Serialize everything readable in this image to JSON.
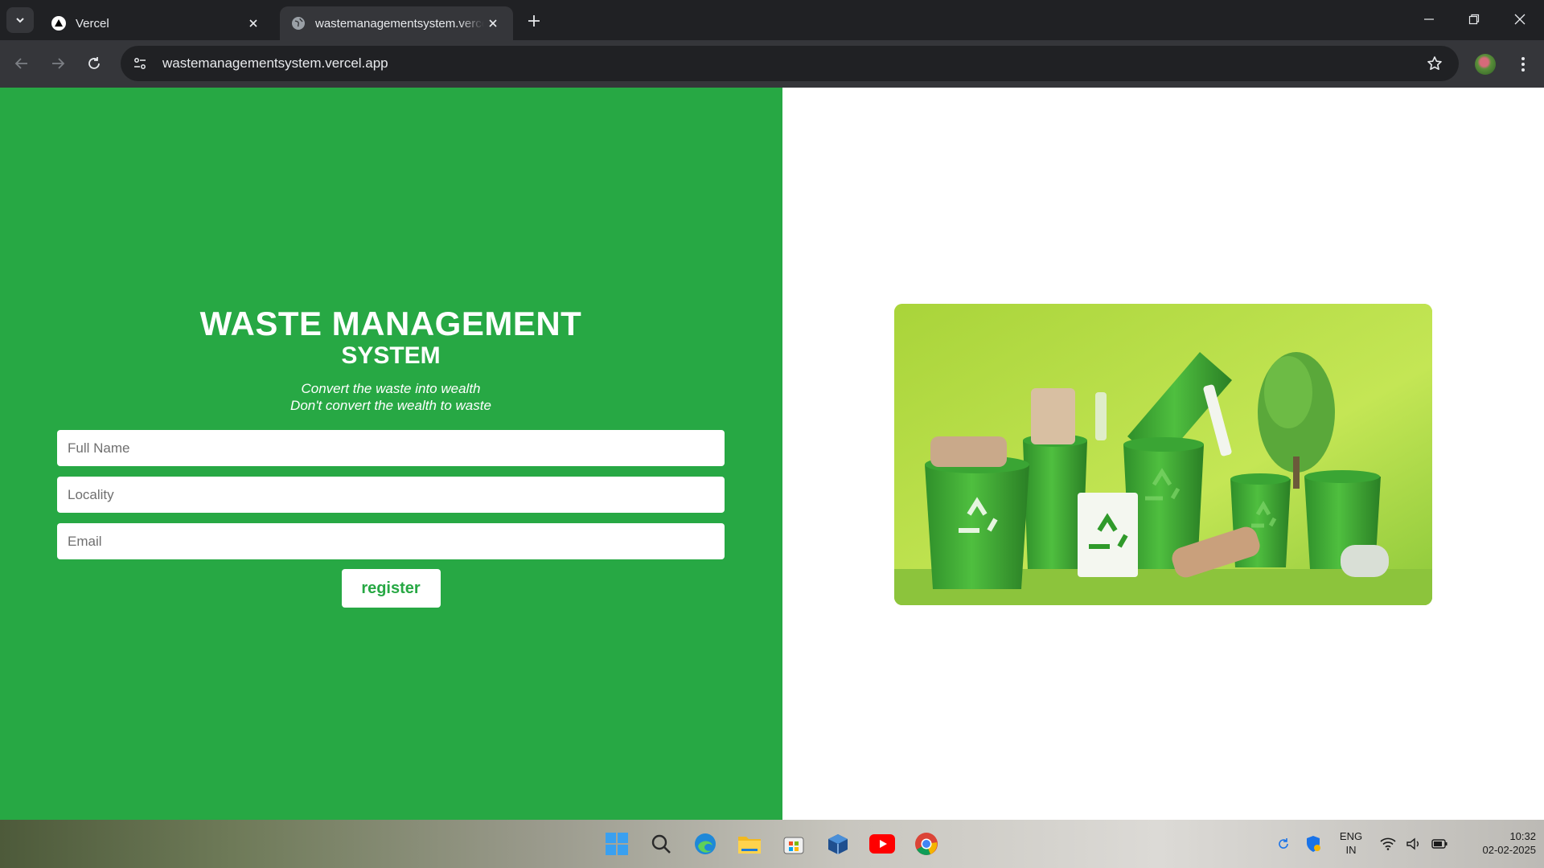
{
  "browser": {
    "tabs": [
      {
        "title": "Vercel",
        "active": false,
        "favicon": "vercel-triangle-icon"
      },
      {
        "title": "wastemanagementsystem.vercel.app",
        "active": true,
        "favicon": "globe-icon"
      }
    ],
    "url": "wastemanagementsystem.vercel.app"
  },
  "page": {
    "heading_line1": "WASTE MANAGEMENT",
    "heading_line2": "SYSTEM",
    "tagline_line1": "Convert the waste into wealth",
    "tagline_line2": "Don't convert the wealth to waste",
    "form": {
      "full_name_placeholder": "Full Name",
      "locality_placeholder": "Locality",
      "email_placeholder": "Email",
      "submit_label": "register"
    },
    "hero_image": "recycling-bins-image"
  },
  "taskbar": {
    "pinned": [
      "windows-start-icon",
      "search-icon",
      "edge-icon",
      "file-explorer-icon",
      "store-icon",
      "virtualbox-icon",
      "youtube-icon",
      "chrome-icon"
    ],
    "lang_line1": "ENG",
    "lang_line2": "IN",
    "time": "10:32",
    "date": "02-02-2025"
  },
  "colors": {
    "brand_green": "#27a844",
    "chrome_dark": "#202124",
    "chrome_toolbar": "#35363a"
  }
}
